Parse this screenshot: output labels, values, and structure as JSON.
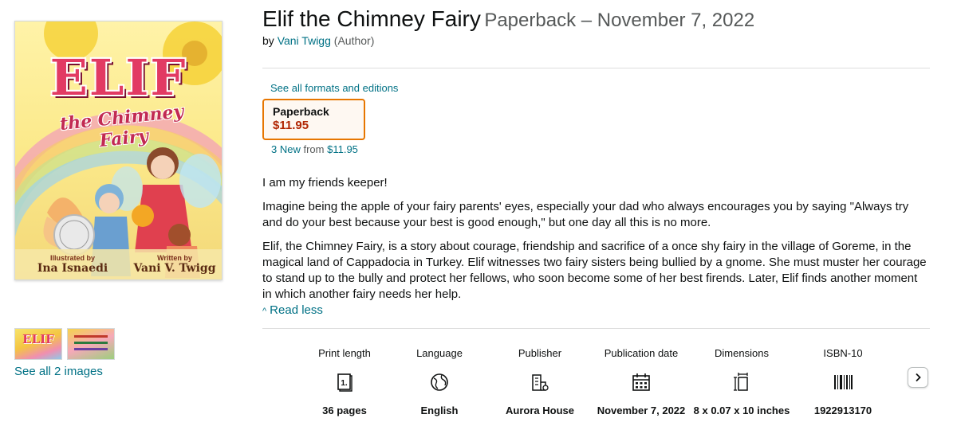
{
  "cover": {
    "title": "ELIF",
    "subtitle": "the Chimney Fairy",
    "illustrated_by_label": "Illustrated by",
    "illustrator": "Ina Isnaedi",
    "written_by_label": "Written by",
    "writer": "Vani V. Twigg"
  },
  "thumbnails": {
    "thumb1_text": "ELIF",
    "see_all": "See all 2 images"
  },
  "product": {
    "title": "Elif the Chimney Fairy",
    "format_and_date": "Paperback – November 7, 2022",
    "by": "by",
    "author": "Vani Twigg",
    "author_role": "(Author)"
  },
  "formats": {
    "see_all": "See all formats and editions",
    "selected_name": "Paperback",
    "selected_price": "$11.95",
    "new_count": "3 New",
    "from_label": "from",
    "from_price": "$11.95"
  },
  "description": {
    "p1": "I am my friends keeper!",
    "p2": "Imagine being the apple of your fairy parents' eyes, especially your dad who always encourages you by saying \"Always try and do your best because your best is good enough,\" but one day all this is no more.",
    "p3": "Elif, the Chimney Fairy, is a story about courage, friendship and sacrifice of a once shy fairy in the village of Goreme, in the magical land of Cappadocia in Turkey. Elif witnesses two fairy sisters being bullied by a gnome. She must muster her courage to stand up to the bully and protect her fellows, who soon become some of her best firends. Later, Elif finds another moment in which another fairy needs her help.",
    "read_less": "Read less"
  },
  "details": [
    {
      "label": "Print length",
      "icon": "book-pages-icon",
      "value": "36 pages"
    },
    {
      "label": "Language",
      "icon": "globe-icon",
      "value": "English"
    },
    {
      "label": "Publisher",
      "icon": "building-icon",
      "value": "Aurora House"
    },
    {
      "label": "Publication date",
      "icon": "calendar-icon",
      "value": "November 7, 2022"
    },
    {
      "label": "Dimensions",
      "icon": "ruler-book-icon",
      "value": "8 x 0.07 x 10 inches"
    },
    {
      "label": "ISBN-10",
      "icon": "barcode-icon",
      "value": "1922913170"
    }
  ],
  "colors": {
    "link": "#007185",
    "price": "#b12704",
    "selected_border": "#e77600",
    "text": "#0f1111",
    "muted": "#565959"
  }
}
